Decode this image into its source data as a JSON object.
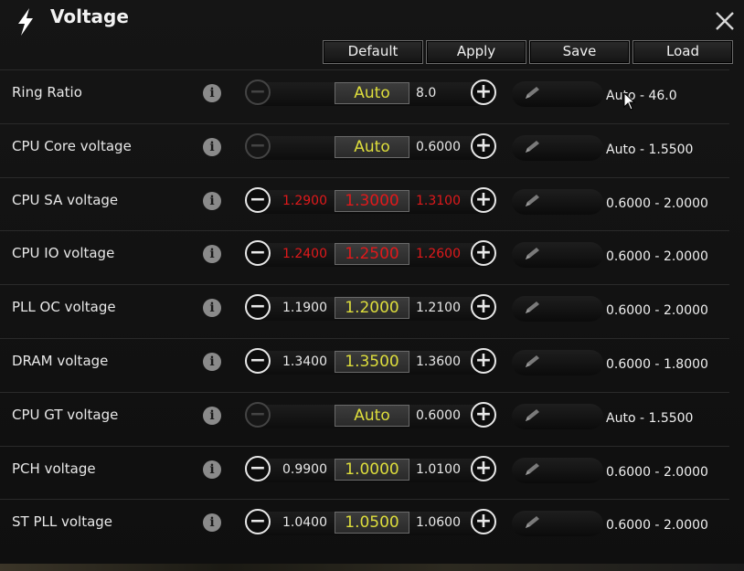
{
  "window": {
    "title": "Voltage",
    "title_icon": "lightning-icon",
    "close_icon": "close-icon"
  },
  "toolbar": {
    "default_label": "Default",
    "apply_label": "Apply",
    "save_label": "Save",
    "load_label": "Load"
  },
  "rows": [
    {
      "label": "Ring Ratio",
      "value": "Auto",
      "low": "",
      "high": "8.0",
      "range": "Auto - 46.0",
      "minus_disabled": true,
      "red": false
    },
    {
      "label": "CPU Core voltage",
      "value": "Auto",
      "low": "",
      "high": "0.6000",
      "range": "Auto - 1.5500",
      "minus_disabled": true,
      "red": false
    },
    {
      "label": "CPU SA voltage",
      "value": "1.3000",
      "low": "1.2900",
      "high": "1.3100",
      "range": "0.6000 - 2.0000",
      "minus_disabled": false,
      "red": true
    },
    {
      "label": "CPU IO voltage",
      "value": "1.2500",
      "low": "1.2400",
      "high": "1.2600",
      "range": "0.6000 - 2.0000",
      "minus_disabled": false,
      "red": true
    },
    {
      "label": "PLL OC voltage",
      "value": "1.2000",
      "low": "1.1900",
      "high": "1.2100",
      "range": "0.6000 - 2.0000",
      "minus_disabled": false,
      "red": false
    },
    {
      "label": "DRAM voltage",
      "value": "1.3500",
      "low": "1.3400",
      "high": "1.3600",
      "range": "0.6000 - 1.8000",
      "minus_disabled": false,
      "red": false
    },
    {
      "label": "CPU GT voltage",
      "value": "Auto",
      "low": "",
      "high": "0.6000",
      "range": "Auto - 1.5500",
      "minus_disabled": true,
      "red": false
    },
    {
      "label": "PCH voltage",
      "value": "1.0000",
      "low": "0.9900",
      "high": "1.0100",
      "range": "0.6000 - 2.0000",
      "minus_disabled": false,
      "red": false
    },
    {
      "label": "ST PLL voltage",
      "value": "1.0500",
      "low": "1.0400",
      "high": "1.0600",
      "range": "0.6000 - 2.0000",
      "minus_disabled": false,
      "red": false
    }
  ],
  "icons": {
    "info": "info-icon",
    "minus": "minus-icon",
    "plus": "plus-icon",
    "edit": "pencil-icon"
  },
  "glyphs": {
    "info": "i",
    "minus": "−",
    "plus": "+"
  },
  "colors": {
    "value_yellow": "#dede3c",
    "value_red": "#e82222",
    "background": "#111111"
  }
}
